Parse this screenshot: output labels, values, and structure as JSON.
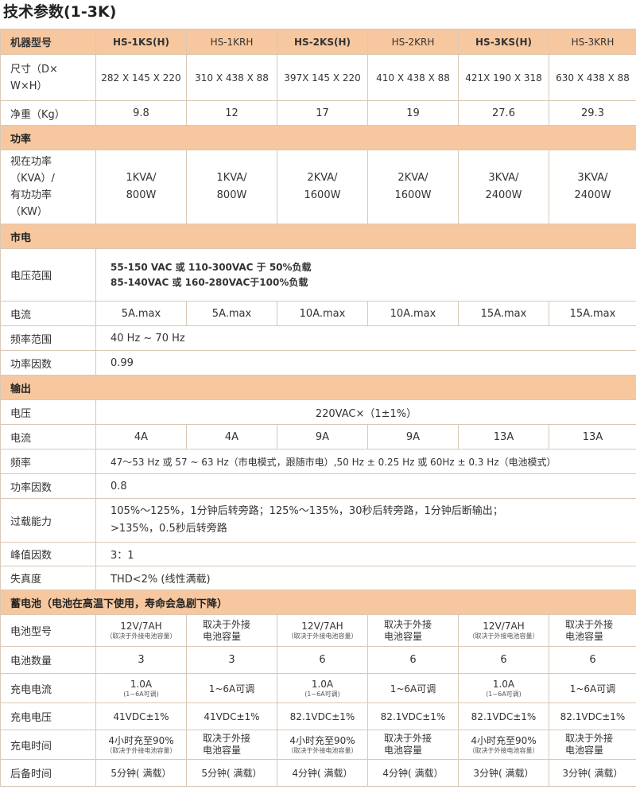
{
  "title": "技术参数(1-3K)",
  "header": {
    "label": "机器型号",
    "models": [
      "HS-1KS(H)",
      "HS-1KRH",
      "HS-2KS(H)",
      "HS-2KRH",
      "HS-3KS(H)",
      "HS-3KRH"
    ]
  },
  "size": {
    "label_line1": "尺寸（D×",
    "label_line2": "W×H）",
    "values": [
      "282 X 145 X 220",
      "310 X 438 X 88",
      "397X 145 X 220",
      "410 X 438 X 88",
      "421X 190 X 318",
      "630 X 438 X 88"
    ]
  },
  "weight": {
    "label": "净重（Kg）",
    "values": [
      "9.8",
      "12",
      "17",
      "19",
      "27.6",
      "29.3"
    ]
  },
  "section_power": "功率",
  "power": {
    "label_lines": [
      "视在功率",
      "（KVA）/",
      "有功功率",
      "（KW）"
    ],
    "values": [
      [
        "1KVA/",
        "800W"
      ],
      [
        "1KVA/",
        "800W"
      ],
      [
        "2KVA/",
        "1600W"
      ],
      [
        "2KVA/",
        "1600W"
      ],
      [
        "3KVA/",
        "2400W"
      ],
      [
        "3KVA/",
        "2400W"
      ]
    ]
  },
  "section_mains": "市电",
  "mains": {
    "voltage_label": "电压范围",
    "voltage_line1": "55-150 VAC 或 110-300VAC 于 50%负载",
    "voltage_line2": "85-140VAC 或 160-280VAC于100%负载",
    "current_label": "电流",
    "current_values": [
      "5A.max",
      "5A.max",
      "10A.max",
      "10A.max",
      "15A.max",
      "15A.max"
    ],
    "freq_label": "频率范围",
    "freq_value": "40 Hz ~ 70 Hz",
    "pf_label": "功率因数",
    "pf_value": "0.99"
  },
  "section_output": "输出",
  "output": {
    "voltage_label": "电压",
    "voltage_value": "220VAC×（1±1%）",
    "current_label": "电流",
    "current_values": [
      "4A",
      "4A",
      "9A",
      "9A",
      "13A",
      "13A"
    ],
    "freq_label": "频率",
    "freq_value": "47～53 Hz 或 57 ~ 63 Hz（市电模式，跟随市电）,50 Hz ± 0.25 Hz 或 60Hz ± 0.3 Hz（电池模式）",
    "pf_label": "功率因数",
    "pf_value": "0.8",
    "overload_label": "过载能力",
    "overload_line1": "105%～125%，1分钟后转旁路；125%～135%，30秒后转旁路，1分钟后断输出；",
    "overload_line2": ">135%，0.5秒后转旁路",
    "crest_label": "峰值因数",
    "crest_value": "3：1",
    "thd_label": "失真度",
    "thd_value": "THD<2% (线性满载)"
  },
  "section_battery": "蓄电池（电池在高温下使用，寿命会急剧下降）",
  "battery": {
    "type_label": "电池型号",
    "type_values": [
      {
        "main": "12V/7AH",
        "sub": "（取决于外接电池容量）"
      },
      {
        "main": "取决于外接",
        "sub": "电池容量"
      },
      {
        "main": "12V/7AH",
        "sub": "（取决于外接电池容量）"
      },
      {
        "main": "取决于外接",
        "sub": "电池容量"
      },
      {
        "main": "12V/7AH",
        "sub": "（取决于外接电池容量）"
      },
      {
        "main": "取决于外接",
        "sub": "电池容量"
      }
    ],
    "count_label": "电池数量",
    "count_values": [
      "3",
      "3",
      "6",
      "6",
      "6",
      "6"
    ],
    "charge_current_label": "充电电流",
    "charge_current_values": [
      {
        "main": "1.0A",
        "sub": "(1~6A可调)"
      },
      {
        "main": "1~6A可调",
        "sub": ""
      },
      {
        "main": "1.0A",
        "sub": "(1~6A可调)"
      },
      {
        "main": "1~6A可调",
        "sub": ""
      },
      {
        "main": "1.0A",
        "sub": "(1~6A可调)"
      },
      {
        "main": "1~6A可调",
        "sub": ""
      }
    ],
    "charge_voltage_label": "充电电压",
    "charge_voltage_values": [
      "41VDC±1%",
      "41VDC±1%",
      "82.1VDC±1%",
      "82.1VDC±1%",
      "82.1VDC±1%",
      "82.1VDC±1%"
    ],
    "charge_time_label": "充电时间",
    "charge_time_values": [
      {
        "main": "4小时充至90%",
        "sub": "（取决于外接电池容量）"
      },
      {
        "main": "取决于外接",
        "sub": "电池容量"
      },
      {
        "main": "4小时充至90%",
        "sub": "（取决于外接电池容量）"
      },
      {
        "main": "取决于外接",
        "sub": "电池容量"
      },
      {
        "main": "4小时充至90%",
        "sub": "（取决于外接电池容量）"
      },
      {
        "main": "取决于外接",
        "sub": "电池容量"
      }
    ],
    "backup_label": "后备时间",
    "backup_values": [
      "5分钟( 满载）",
      "5分钟( 满载）",
      "4分钟( 满载）",
      "4分钟( 满载）",
      "3分钟( 满载）",
      "3分钟( 满载）"
    ]
  }
}
